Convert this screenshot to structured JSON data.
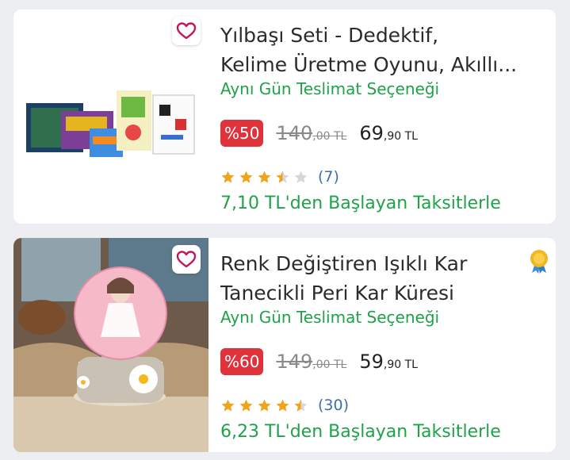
{
  "products": [
    {
      "title_line1": "Yılbaşı Seti - Dedektif,",
      "title_line2": "Kelime Üretme Oyunu, Akıllı...",
      "delivery": "Aynı Gün Teslimat Seçeneği",
      "discount": "%50",
      "old_price_int": "140",
      "old_price_dec": ",00 TL",
      "new_price_int": "69",
      "new_price_dec": ",90 TL",
      "rating": 3.5,
      "review_count": "(7)",
      "installment": "7,10 TL'den Başlayan Taksitlerle"
    },
    {
      "title_line1": "Renk Değiştiren Işıklı Kar",
      "title_line2": "Tanecikli Peri Kar Küresi",
      "delivery": "Aynı Gün Teslimat Seçeneği",
      "discount": "%60",
      "old_price_int": "149",
      "old_price_dec": ",00 TL",
      "new_price_int": "59",
      "new_price_dec": ",90 TL",
      "rating": 4.5,
      "review_count": "(30)",
      "installment": "6,23 TL'den Başlayan Taksitlerle",
      "badge_icon": "award-ribbon-icon"
    }
  ],
  "colors": {
    "green": "#1fa24a",
    "discount": "#e0323a",
    "star": "#f2a31b",
    "star_empty": "#d4d8dd",
    "link": "#3f6fa8",
    "heart": "#c2185b"
  }
}
